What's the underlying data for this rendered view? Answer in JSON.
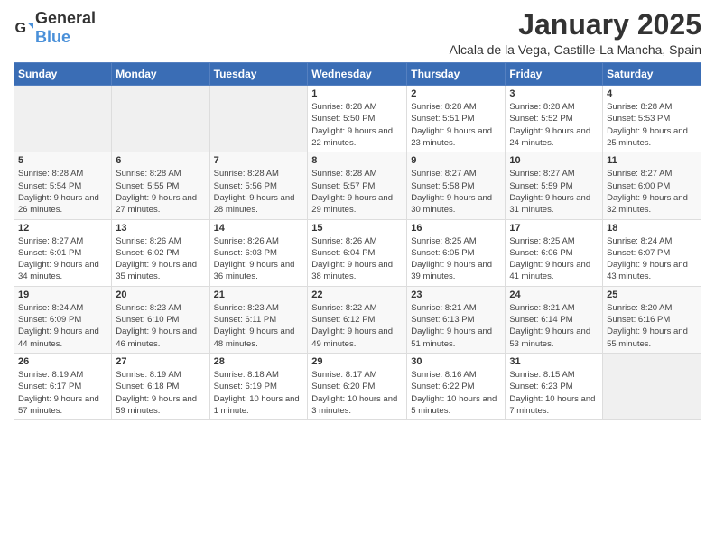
{
  "logo": {
    "general": "General",
    "blue": "Blue"
  },
  "header": {
    "month": "January 2025",
    "location": "Alcala de la Vega, Castille-La Mancha, Spain"
  },
  "weekdays": [
    "Sunday",
    "Monday",
    "Tuesday",
    "Wednesday",
    "Thursday",
    "Friday",
    "Saturday"
  ],
  "weeks": [
    [
      {
        "day": "",
        "sunrise": "",
        "sunset": "",
        "daylight": ""
      },
      {
        "day": "",
        "sunrise": "",
        "sunset": "",
        "daylight": ""
      },
      {
        "day": "",
        "sunrise": "",
        "sunset": "",
        "daylight": ""
      },
      {
        "day": "1",
        "sunrise": "Sunrise: 8:28 AM",
        "sunset": "Sunset: 5:50 PM",
        "daylight": "Daylight: 9 hours and 22 minutes."
      },
      {
        "day": "2",
        "sunrise": "Sunrise: 8:28 AM",
        "sunset": "Sunset: 5:51 PM",
        "daylight": "Daylight: 9 hours and 23 minutes."
      },
      {
        "day": "3",
        "sunrise": "Sunrise: 8:28 AM",
        "sunset": "Sunset: 5:52 PM",
        "daylight": "Daylight: 9 hours and 24 minutes."
      },
      {
        "day": "4",
        "sunrise": "Sunrise: 8:28 AM",
        "sunset": "Sunset: 5:53 PM",
        "daylight": "Daylight: 9 hours and 25 minutes."
      }
    ],
    [
      {
        "day": "5",
        "sunrise": "Sunrise: 8:28 AM",
        "sunset": "Sunset: 5:54 PM",
        "daylight": "Daylight: 9 hours and 26 minutes."
      },
      {
        "day": "6",
        "sunrise": "Sunrise: 8:28 AM",
        "sunset": "Sunset: 5:55 PM",
        "daylight": "Daylight: 9 hours and 27 minutes."
      },
      {
        "day": "7",
        "sunrise": "Sunrise: 8:28 AM",
        "sunset": "Sunset: 5:56 PM",
        "daylight": "Daylight: 9 hours and 28 minutes."
      },
      {
        "day": "8",
        "sunrise": "Sunrise: 8:28 AM",
        "sunset": "Sunset: 5:57 PM",
        "daylight": "Daylight: 9 hours and 29 minutes."
      },
      {
        "day": "9",
        "sunrise": "Sunrise: 8:27 AM",
        "sunset": "Sunset: 5:58 PM",
        "daylight": "Daylight: 9 hours and 30 minutes."
      },
      {
        "day": "10",
        "sunrise": "Sunrise: 8:27 AM",
        "sunset": "Sunset: 5:59 PM",
        "daylight": "Daylight: 9 hours and 31 minutes."
      },
      {
        "day": "11",
        "sunrise": "Sunrise: 8:27 AM",
        "sunset": "Sunset: 6:00 PM",
        "daylight": "Daylight: 9 hours and 32 minutes."
      }
    ],
    [
      {
        "day": "12",
        "sunrise": "Sunrise: 8:27 AM",
        "sunset": "Sunset: 6:01 PM",
        "daylight": "Daylight: 9 hours and 34 minutes."
      },
      {
        "day": "13",
        "sunrise": "Sunrise: 8:26 AM",
        "sunset": "Sunset: 6:02 PM",
        "daylight": "Daylight: 9 hours and 35 minutes."
      },
      {
        "day": "14",
        "sunrise": "Sunrise: 8:26 AM",
        "sunset": "Sunset: 6:03 PM",
        "daylight": "Daylight: 9 hours and 36 minutes."
      },
      {
        "day": "15",
        "sunrise": "Sunrise: 8:26 AM",
        "sunset": "Sunset: 6:04 PM",
        "daylight": "Daylight: 9 hours and 38 minutes."
      },
      {
        "day": "16",
        "sunrise": "Sunrise: 8:25 AM",
        "sunset": "Sunset: 6:05 PM",
        "daylight": "Daylight: 9 hours and 39 minutes."
      },
      {
        "day": "17",
        "sunrise": "Sunrise: 8:25 AM",
        "sunset": "Sunset: 6:06 PM",
        "daylight": "Daylight: 9 hours and 41 minutes."
      },
      {
        "day": "18",
        "sunrise": "Sunrise: 8:24 AM",
        "sunset": "Sunset: 6:07 PM",
        "daylight": "Daylight: 9 hours and 43 minutes."
      }
    ],
    [
      {
        "day": "19",
        "sunrise": "Sunrise: 8:24 AM",
        "sunset": "Sunset: 6:09 PM",
        "daylight": "Daylight: 9 hours and 44 minutes."
      },
      {
        "day": "20",
        "sunrise": "Sunrise: 8:23 AM",
        "sunset": "Sunset: 6:10 PM",
        "daylight": "Daylight: 9 hours and 46 minutes."
      },
      {
        "day": "21",
        "sunrise": "Sunrise: 8:23 AM",
        "sunset": "Sunset: 6:11 PM",
        "daylight": "Daylight: 9 hours and 48 minutes."
      },
      {
        "day": "22",
        "sunrise": "Sunrise: 8:22 AM",
        "sunset": "Sunset: 6:12 PM",
        "daylight": "Daylight: 9 hours and 49 minutes."
      },
      {
        "day": "23",
        "sunrise": "Sunrise: 8:21 AM",
        "sunset": "Sunset: 6:13 PM",
        "daylight": "Daylight: 9 hours and 51 minutes."
      },
      {
        "day": "24",
        "sunrise": "Sunrise: 8:21 AM",
        "sunset": "Sunset: 6:14 PM",
        "daylight": "Daylight: 9 hours and 53 minutes."
      },
      {
        "day": "25",
        "sunrise": "Sunrise: 8:20 AM",
        "sunset": "Sunset: 6:16 PM",
        "daylight": "Daylight: 9 hours and 55 minutes."
      }
    ],
    [
      {
        "day": "26",
        "sunrise": "Sunrise: 8:19 AM",
        "sunset": "Sunset: 6:17 PM",
        "daylight": "Daylight: 9 hours and 57 minutes."
      },
      {
        "day": "27",
        "sunrise": "Sunrise: 8:19 AM",
        "sunset": "Sunset: 6:18 PM",
        "daylight": "Daylight: 9 hours and 59 minutes."
      },
      {
        "day": "28",
        "sunrise": "Sunrise: 8:18 AM",
        "sunset": "Sunset: 6:19 PM",
        "daylight": "Daylight: 10 hours and 1 minute."
      },
      {
        "day": "29",
        "sunrise": "Sunrise: 8:17 AM",
        "sunset": "Sunset: 6:20 PM",
        "daylight": "Daylight: 10 hours and 3 minutes."
      },
      {
        "day": "30",
        "sunrise": "Sunrise: 8:16 AM",
        "sunset": "Sunset: 6:22 PM",
        "daylight": "Daylight: 10 hours and 5 minutes."
      },
      {
        "day": "31",
        "sunrise": "Sunrise: 8:15 AM",
        "sunset": "Sunset: 6:23 PM",
        "daylight": "Daylight: 10 hours and 7 minutes."
      },
      {
        "day": "",
        "sunrise": "",
        "sunset": "",
        "daylight": ""
      }
    ]
  ]
}
